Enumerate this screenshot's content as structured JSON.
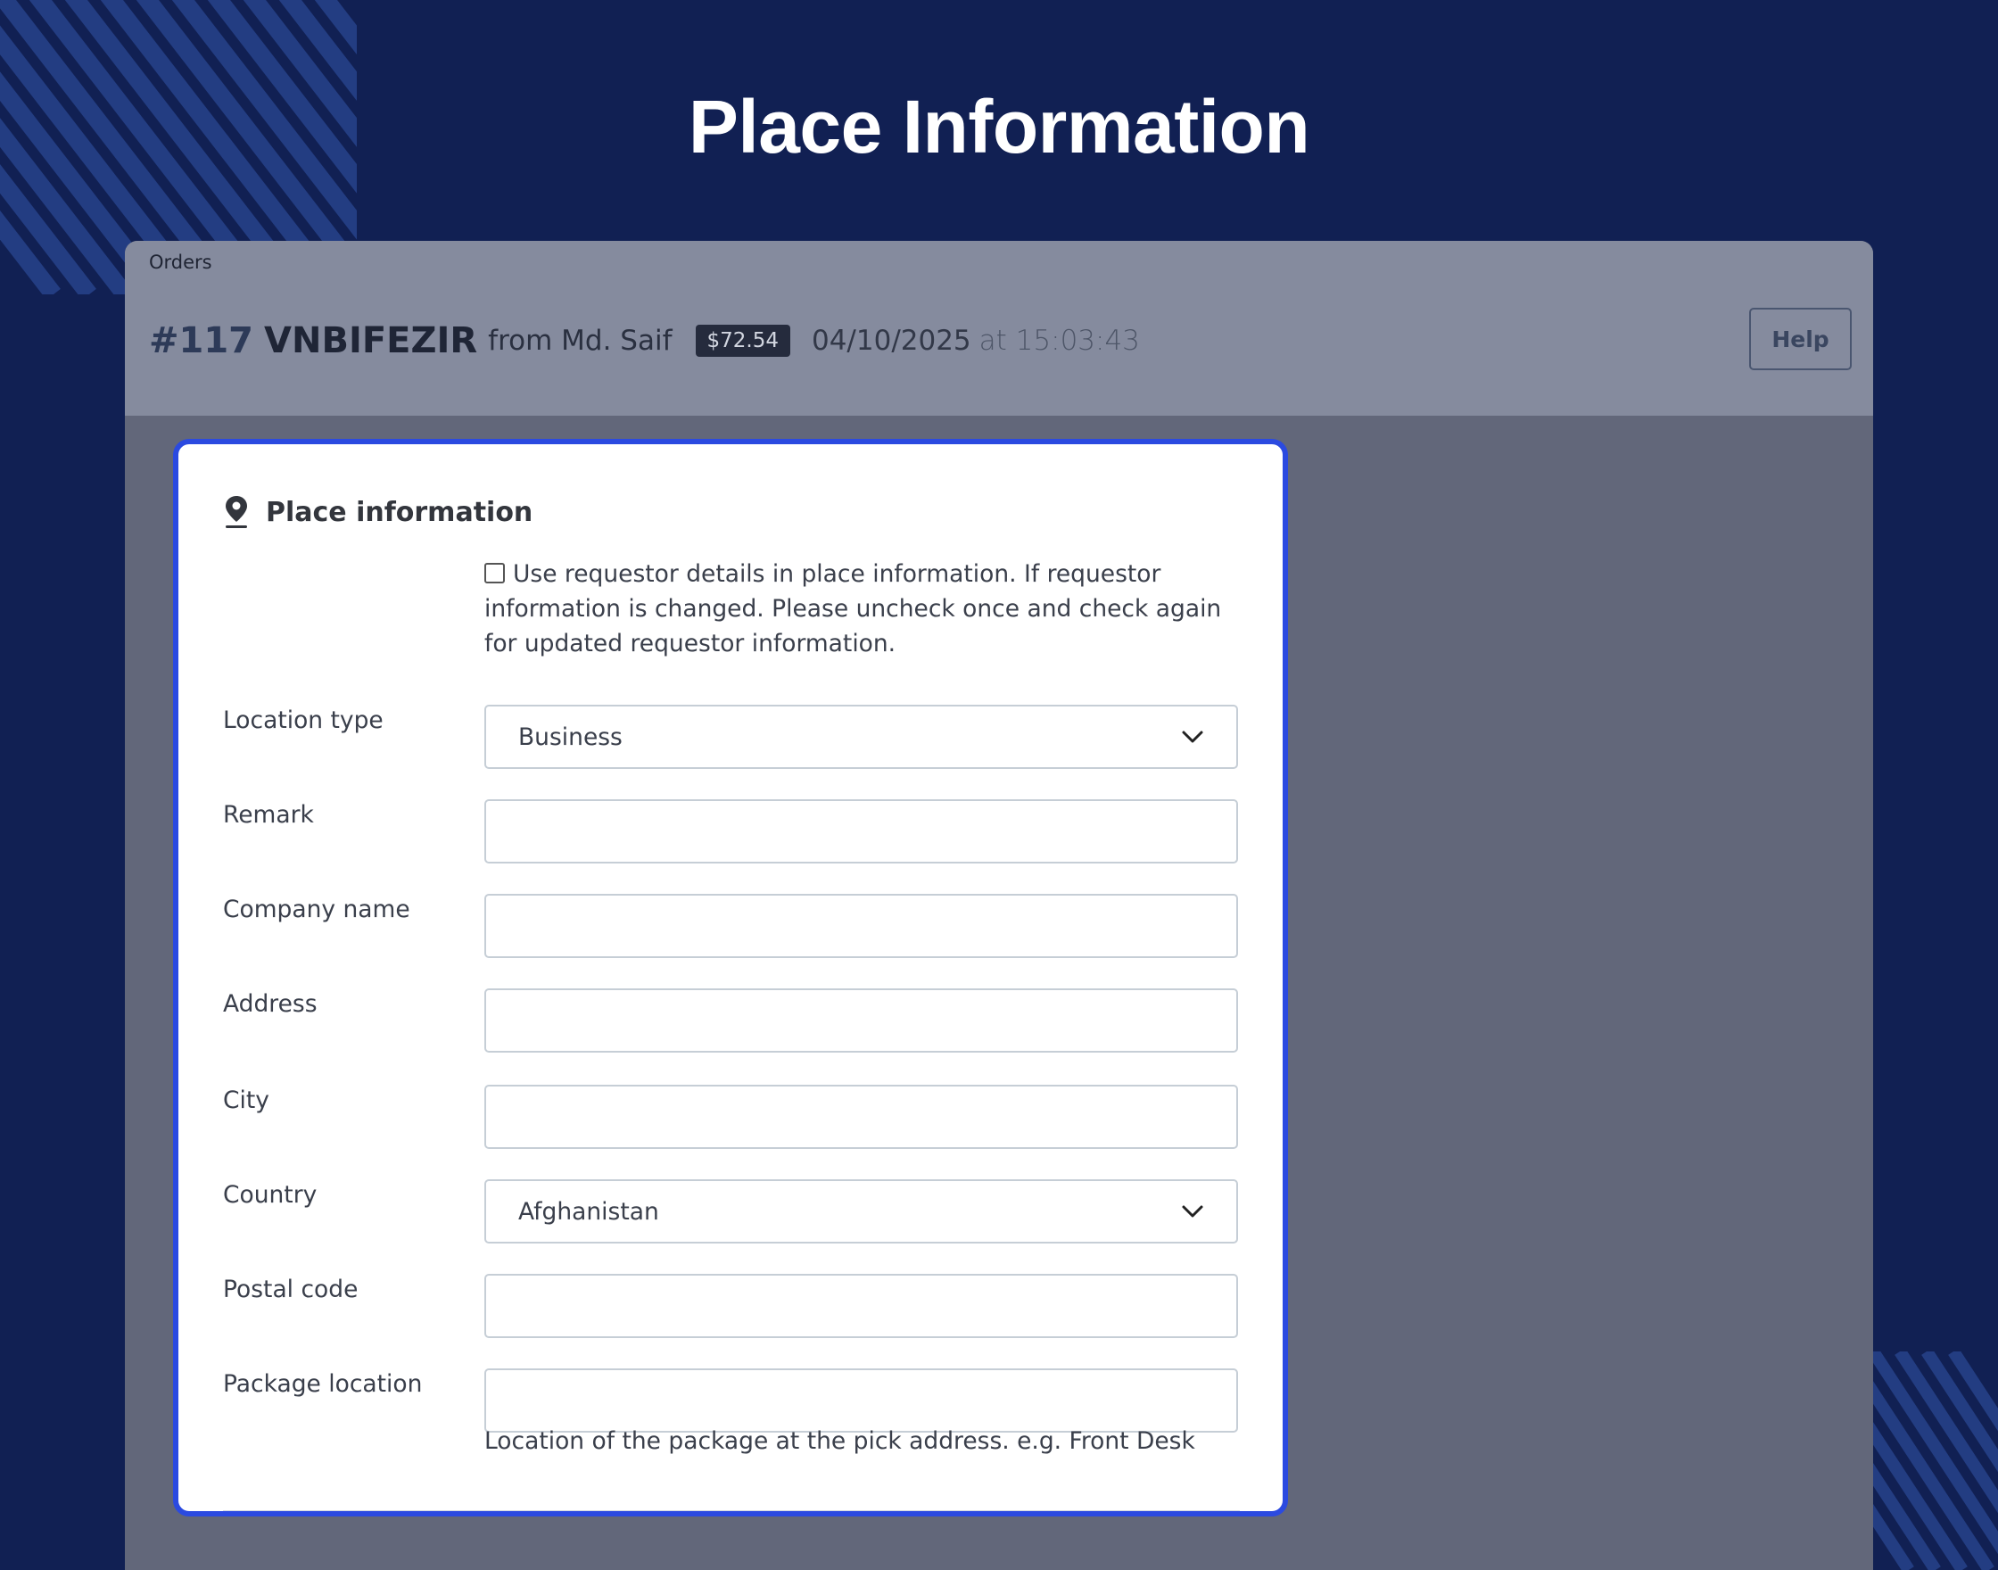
{
  "page_title": "Place Information",
  "header": {
    "breadcrumb": "Orders",
    "order_number": "#117",
    "order_code": "VNBIFEZIR",
    "from_text": "from Md. Saif",
    "price": "$72.54",
    "date": "04/10/2025",
    "time_text": "at 15:03:43",
    "help_label": "Help"
  },
  "card": {
    "title": "Place information",
    "icon": "map-pin-icon",
    "use_requestor_checked": false,
    "use_requestor_text": "Use requestor details in place information. If requestor information is changed. Please uncheck once and check again for updated requestor information.",
    "fields": {
      "location_type": {
        "label": "Location type",
        "value": "Business"
      },
      "remark": {
        "label": "Remark",
        "value": ""
      },
      "company_name": {
        "label": "Company name",
        "value": ""
      },
      "address": {
        "label": "Address",
        "value": ""
      },
      "city": {
        "label": "City",
        "value": ""
      },
      "country": {
        "label": "Country",
        "value": "Afghanistan"
      },
      "postal_code": {
        "label": "Postal code",
        "value": ""
      },
      "package_location": {
        "label": "Package location",
        "value": ""
      }
    },
    "package_location_help": "Location of the package at the pick address. e.g. Front Desk"
  },
  "colors": {
    "background": "#112053",
    "card_border": "#2b4ae0",
    "header_bg": "#858b9e",
    "content_bg": "#62677a"
  }
}
